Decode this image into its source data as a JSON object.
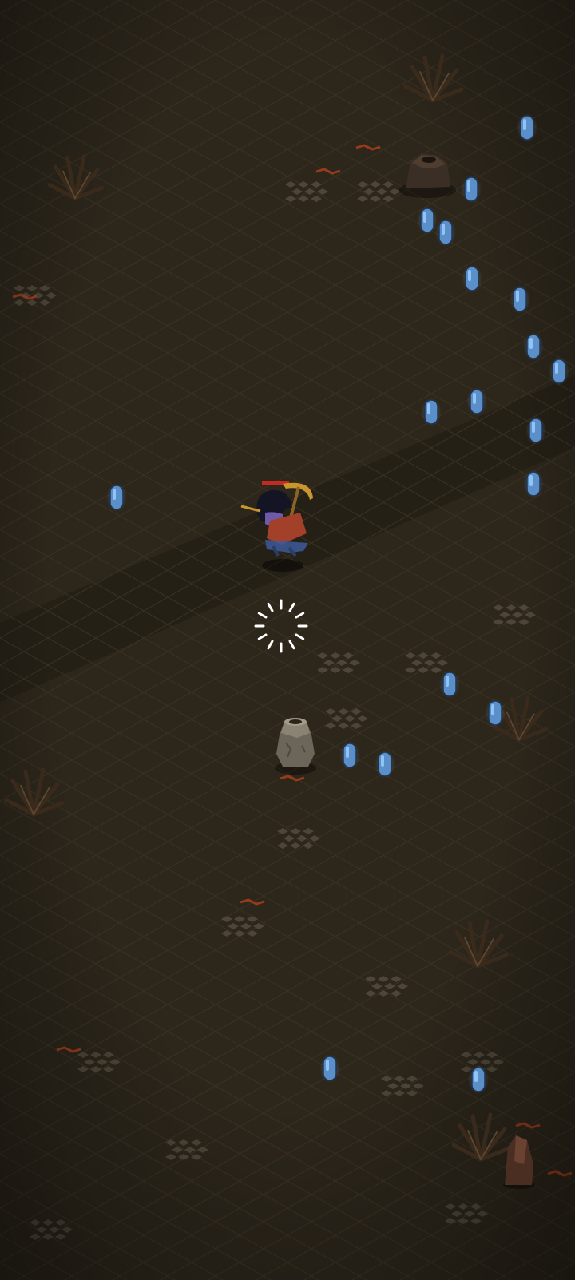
{
  "scene": {
    "type": "isometric-dungeon-floor",
    "floor_color": "#2c261b",
    "grid_line_color": "#3a3224",
    "cobble_color": "#5a5245",
    "lava_color": "#b8431c"
  },
  "player": {
    "name": "",
    "hair_color": "#141524",
    "skin_color": "#6e5aa8",
    "cloak_color": "#a2402a",
    "weapon_color": "#c9962e",
    "health_bar_color": "#c42a22"
  },
  "loading_indicator": {
    "visible": true,
    "color": "#ffffff"
  },
  "pickups": {
    "kind": "blue-crystal",
    "color": "#5b8fc9",
    "glow_color": "#9fd0ff"
  },
  "props": {
    "dead_bush_color": "#3a2a1c",
    "urn_color": "#7d7668",
    "stalagmite_color": "#4a2e22"
  }
}
